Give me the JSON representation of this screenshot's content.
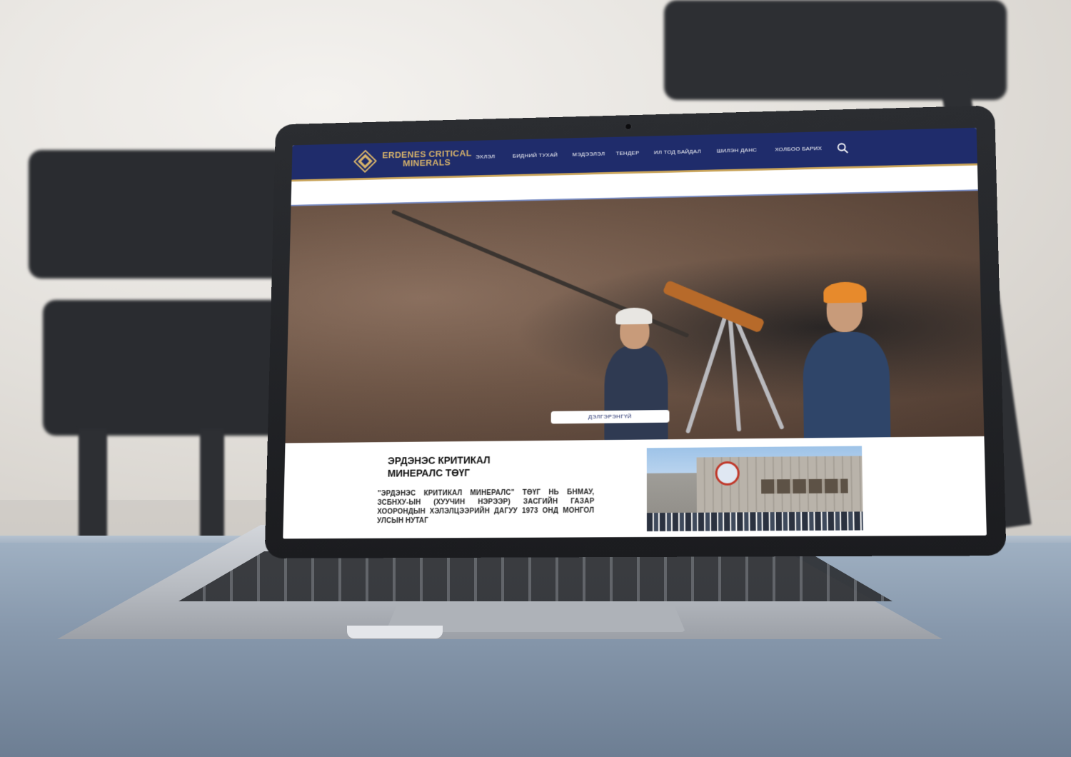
{
  "site": {
    "brand_line1": "ERDENES CRITICAL",
    "brand_line2": "MINERALS",
    "accent_color": "#1f2c6b",
    "gold_color": "#c9a45a"
  },
  "nav": {
    "items": [
      {
        "label": "ЭХЛЭЛ"
      },
      {
        "label": "БИДНИЙ ТУХАЙ"
      },
      {
        "label": "МЭДЭЭЛЭЛ"
      },
      {
        "label": "ТЕНДЕР"
      },
      {
        "label": "ИЛ ТОД БАЙДАЛ"
      },
      {
        "label": "ШИЛЭН ДАНС"
      },
      {
        "label": "ХОЛБОО БАРИХ"
      }
    ],
    "search_icon": "search-icon"
  },
  "hero": {
    "button_label": "ДЭЛГЭРЭНГҮЙ"
  },
  "about": {
    "title_line1": "ЭРДЭНЭС КРИТИКАЛ",
    "title_line2": "МИНЕРАЛС ТӨҮГ",
    "text": "\"ЭРДЭНЭС КРИТИКАЛ МИНЕРАЛС\" ТӨҮГ НЬ БНМАУ, ЗСБНХУ-ЫН (ХУУЧИН НЭРЭЭР) ЗАСГИЙН ГАЗАР ХООРОНДЫН ХЭЛЭЛЦЭЭРИЙН ДАГУУ 1973 ОНД МОНГОЛ УЛСЫН НУТАГ"
  }
}
